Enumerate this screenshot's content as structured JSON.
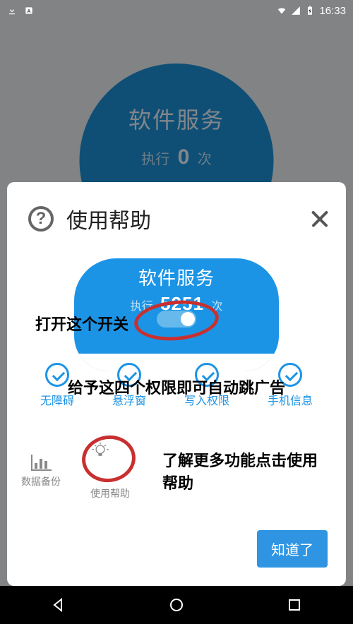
{
  "statusbar": {
    "time": "16:33"
  },
  "background": {
    "title": "软件服务",
    "exec_prefix": "执行",
    "exec_count": "0",
    "exec_suffix": "次"
  },
  "modal": {
    "title": "使用帮助",
    "illustration1": {
      "pill_title": "软件服务",
      "pill_prefix": "执行",
      "pill_count": "5251",
      "pill_suffix": "次",
      "open_label": "打开这个开关"
    },
    "illustration2": {
      "overlay_text": "给予这四个权限即可自动跳广告",
      "perms": [
        "无障碍",
        "悬浮窗",
        "写入权限",
        "手机信息"
      ]
    },
    "illustration3": {
      "mini_1_label": "数据备份",
      "mini_2_label": "使用帮助",
      "desc": "了解更多功能点击使用帮助"
    },
    "confirm_button": "知道了"
  }
}
